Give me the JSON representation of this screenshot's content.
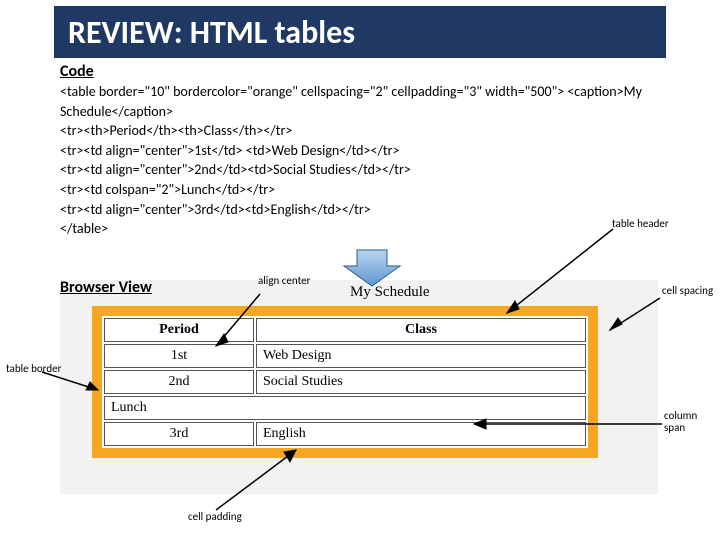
{
  "title": "REVIEW: HTML tables",
  "code_heading": "Code",
  "code_lines": "<table border=\"10\" bordercolor=\"orange\" cellspacing=\"2\" cellpadding=\"3\" width=\"500\"> <caption>My Schedule</caption>\n<tr><th>Period</th><th>Class</th></tr>\n<tr><td align=\"center\">1st</td> <td>Web Design</td></tr>\n<tr><td align=\"center\">2nd</td><td>Social Studies</td></tr>\n<tr><td colspan=\"2\">Lunch</td></tr>\n<tr><td align=\"center\">3rd</td><td>English</td></tr>\n</table>",
  "browser_heading": "Browser View",
  "labels": {
    "table_header": "table\nheader",
    "align_center": "align\ncenter",
    "cell_spacing": "cell\nspacing",
    "table_border": "table\nborder",
    "column_span": "column\nspan",
    "cell_padding": "cell padding"
  },
  "table": {
    "caption": "My Schedule",
    "headers": [
      "Period",
      "Class"
    ],
    "rows": [
      {
        "cells": [
          "1st",
          "Web Design"
        ],
        "align_first": true
      },
      {
        "cells": [
          "2nd",
          "Social Studies"
        ],
        "align_first": true
      },
      {
        "cells": [
          "Lunch"
        ],
        "colspan": 2
      },
      {
        "cells": [
          "3rd",
          "English"
        ],
        "align_first": true
      }
    ]
  },
  "chart_data": {
    "type": "table",
    "title": "My Schedule",
    "columns": [
      "Period",
      "Class"
    ],
    "rows": [
      [
        "1st",
        "Web Design"
      ],
      [
        "2nd",
        "Social Studies"
      ],
      [
        "Lunch",
        ""
      ],
      [
        "3rd",
        "English"
      ]
    ]
  }
}
